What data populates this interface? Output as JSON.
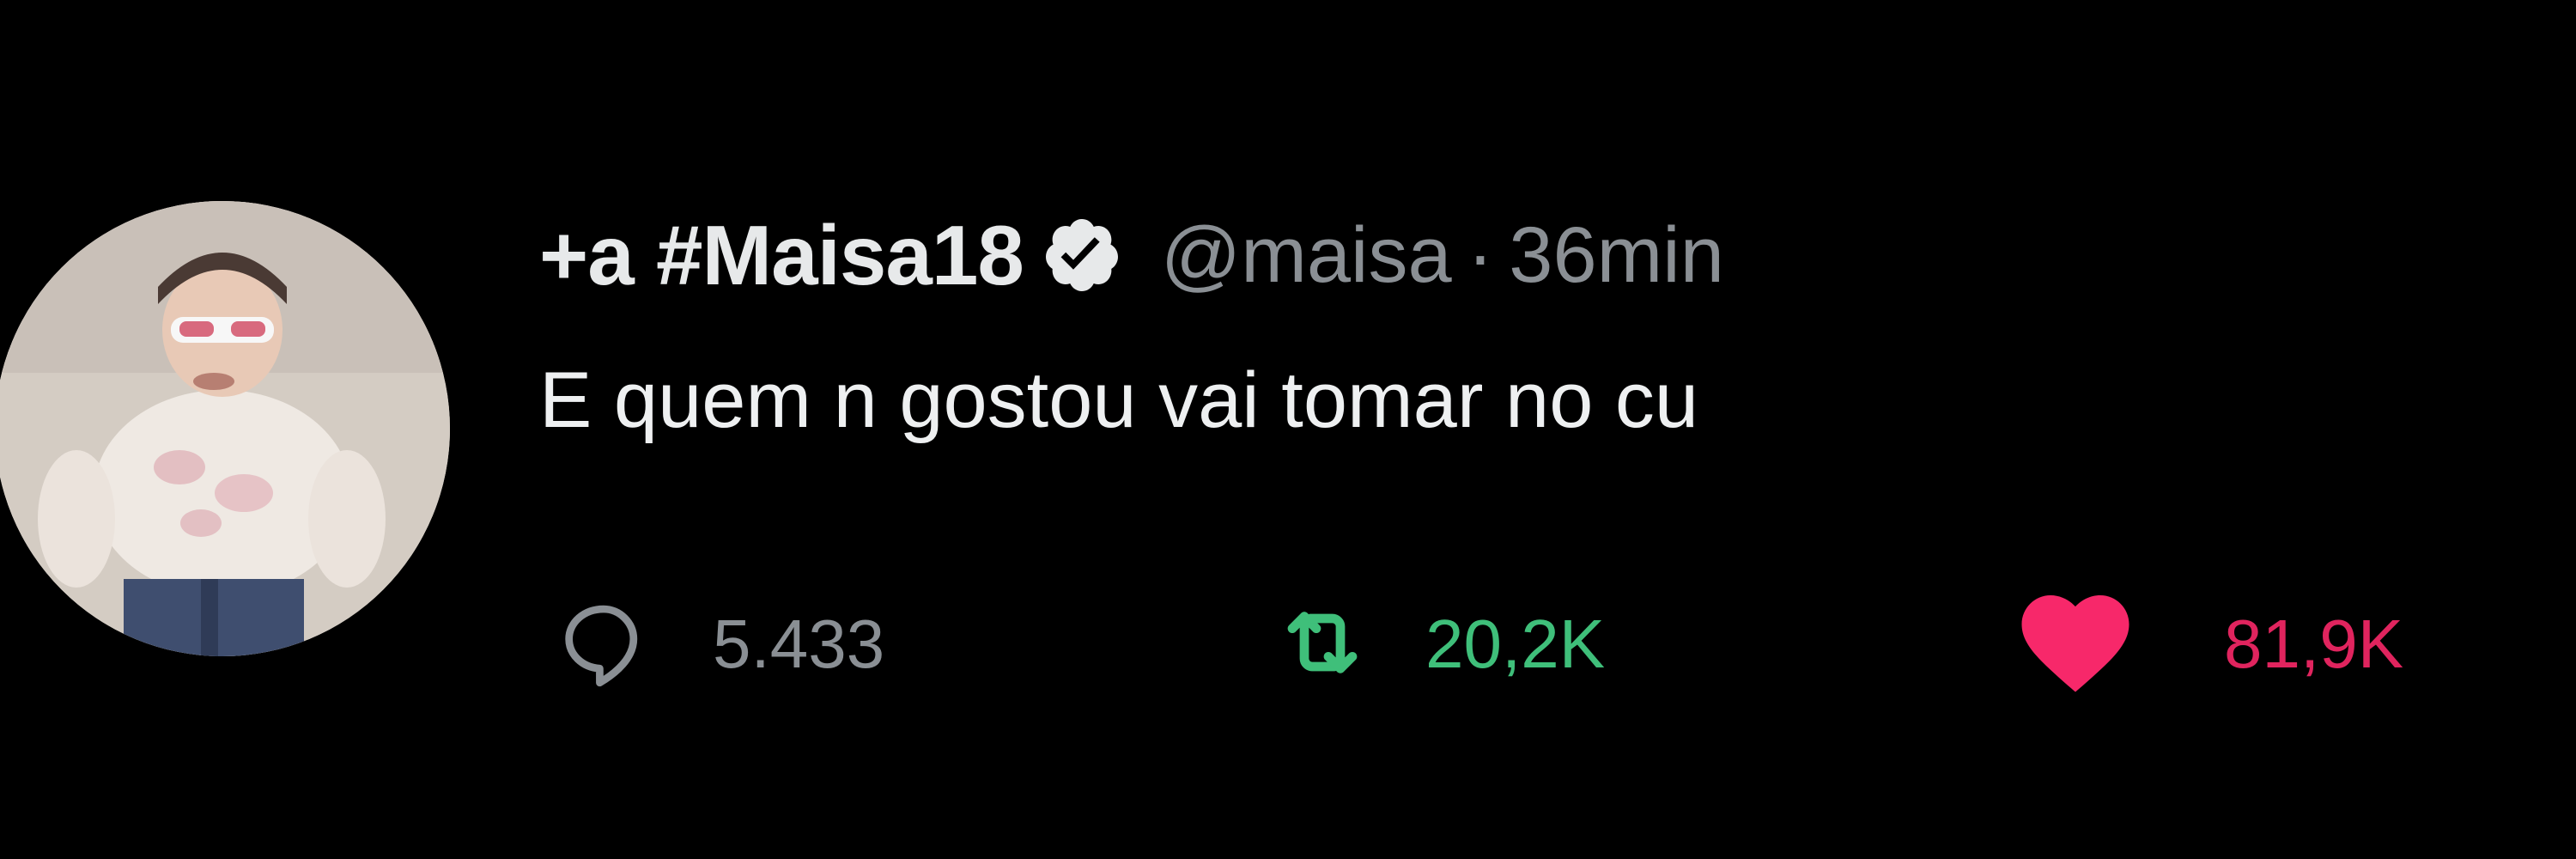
{
  "tweet": {
    "display_name": "+a #Maisa18",
    "handle": "@maisa",
    "separator": "·",
    "time": "36min",
    "text": "E quem n gostou vai tomar no cu"
  },
  "stats": {
    "replies": "5.433",
    "retweets": "20,2K",
    "likes": "81,9K"
  },
  "icons": {
    "verified": "verified-badge-icon",
    "reply": "reply-bubble-icon",
    "retweet": "retweet-arrows-icon",
    "like": "heart-icon"
  },
  "colors": {
    "background": "#000000",
    "text": "#e7e9ea",
    "muted": "#8a8f94",
    "retweet": "#3fbf7a",
    "like": "#e0245e"
  }
}
